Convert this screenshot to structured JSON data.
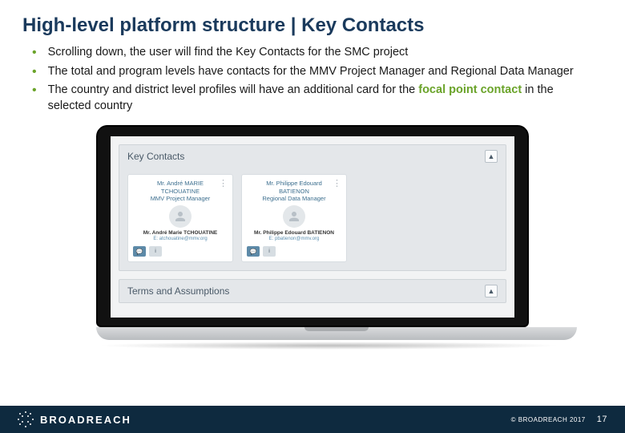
{
  "title": "High-level platform structure | Key Contacts",
  "bullets": [
    {
      "text": "Scrolling down, the user will find the Key Contacts for the SMC project"
    },
    {
      "text": "The total and program levels have contacts for the MMV Project Manager and Regional Data Manager"
    },
    {
      "pre": "The country and district level profiles will have an additional card for the ",
      "em": "focal point contact",
      "post": " in the selected country"
    }
  ],
  "panel1_title": "Key Contacts",
  "panel2_title": "Terms and Assumptions",
  "contacts": [
    {
      "title_l1": "Mr. André MARIE",
      "title_l2": "TCHOUATINE",
      "title_l3": "MMV Project Manager",
      "name": "Mr. André Marie TCHOUATINE",
      "email": "E: atchouatine@mmv.org"
    },
    {
      "title_l1": "Mr. Philippe Edouard",
      "title_l2": "BATIENON",
      "title_l3": "Regional Data Manager",
      "name": "Mr. Philippe Edouard BATIENON",
      "email": "E: pbatienon@mmv.org"
    }
  ],
  "footer": {
    "brand": "BROADREACH",
    "copyright": "© BROADREACH 2017",
    "page": "17"
  },
  "icons": {
    "chat": "💬",
    "info": "i",
    "menu": "⋮",
    "up": "▲"
  }
}
